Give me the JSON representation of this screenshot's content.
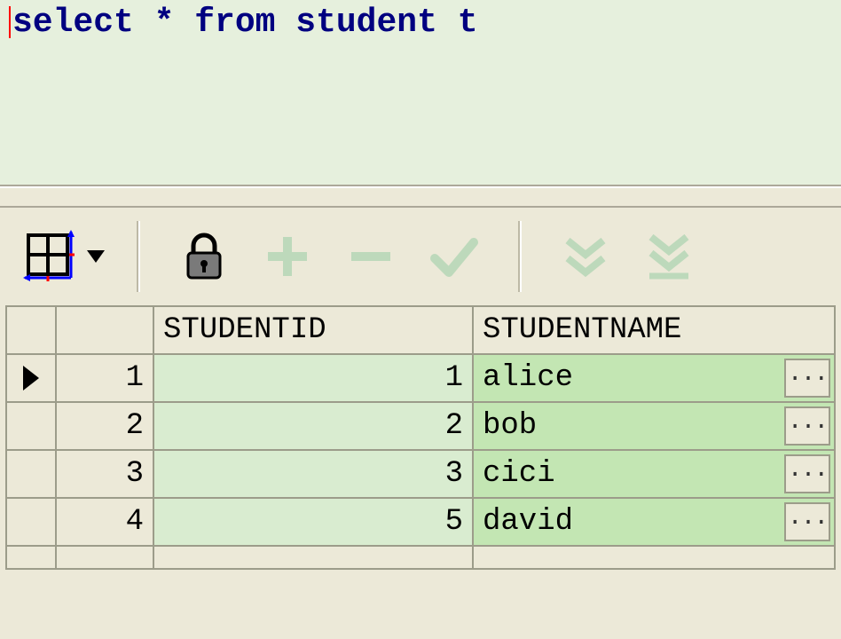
{
  "editor": {
    "sql_kw1": "select",
    "sql_star": " * ",
    "sql_kw2": "from",
    "sql_ident": " student t"
  },
  "toolbar": {
    "grid_label": "Grid view",
    "lock_label": "Lock",
    "add_label": "Add",
    "remove_label": "Remove",
    "commit_label": "Commit",
    "fetch_label": "Fetch",
    "fetch_all_label": "Fetch all"
  },
  "columns": {
    "c1": "STUDENTID",
    "c2": "STUDENTNAME"
  },
  "rows": [
    {
      "n": "1",
      "id": "1",
      "name": "alice"
    },
    {
      "n": "2",
      "id": "2",
      "name": "bob"
    },
    {
      "n": "3",
      "id": "3",
      "name": "cici"
    },
    {
      "n": "4",
      "id": "5",
      "name": "david"
    }
  ],
  "ellipsis": "..."
}
